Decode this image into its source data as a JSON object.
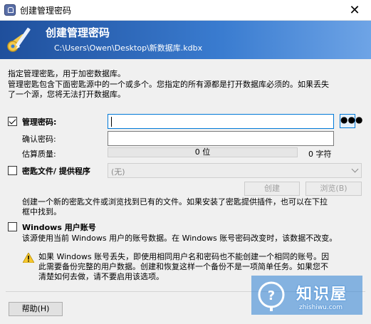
{
  "window": {
    "title": "创建管理密码",
    "close_glyph": "✕"
  },
  "banner": {
    "heading": "创建管理密码",
    "path": "C:\\Users\\Owen\\Desktop\\新数据库.kdbx"
  },
  "intro": {
    "line1": "指定管理密匙，用于加密数据库。",
    "line2a": "管理密匙包含下面密匙源中的一个或多个。您指定的所有源都是打开数据库必须的。如果丢失",
    "line2b": "了一个源，您将无法打开数据库。"
  },
  "master_password": {
    "label": "管理密码:",
    "checked": true,
    "value": "",
    "dots_label": "●●●",
    "confirm_label": "确认密码:",
    "confirm_value": "",
    "quality_label": "估算质量:",
    "quality_value": "0 位",
    "chars_value": "0 字符"
  },
  "key_file": {
    "label": "密匙文件/ 提供程序",
    "checked": false,
    "selected": "(无)",
    "create_label": "创建",
    "browse_label": "浏览(B)",
    "desc_a": "创建一个新的密匙文件或浏览找到已有的文件。如果安装了密匙提供插件，也可以在下拉",
    "desc_b": "框中找到。"
  },
  "windows_account": {
    "label": "Windows 用户账号",
    "checked": false,
    "desc": "该源使用当前 Windows 用户的账号数据。在 Windows 账号密码改变时，该数据不改变。",
    "warn_a": "如果 Windows 账号丢失，即使用相同用户名和密码也不能创建一个相同的账号。因",
    "warn_b": "此需要备份完整的用户数据。创建和恢复这样一个备份不是一项简单任务。如果您不",
    "warn_c": "清楚如何去做，请不要启用该选项。"
  },
  "footer": {
    "help_label": "帮助(H)"
  },
  "watermark": {
    "cn": "知识屋",
    "en": "zhishiwu.com"
  },
  "colors": {
    "banner_start": "#1f4f9c",
    "banner_end": "#6ea4e6",
    "focus": "#0078d7"
  }
}
